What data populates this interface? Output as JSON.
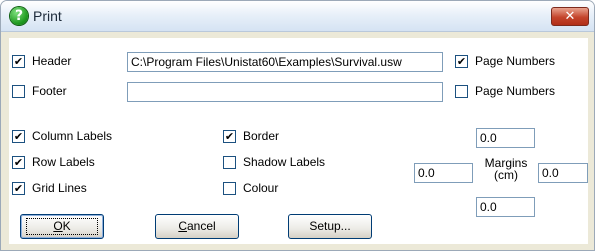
{
  "window": {
    "title": "Print",
    "close_glyph": "✕",
    "help_glyph": "?",
    "help_icon_color": "#2fa02f",
    "close_color": "#c74a31"
  },
  "header": {
    "label": "Header",
    "checked": true,
    "value": "C:\\Program Files\\Unistat60\\Examples\\Survival.usw"
  },
  "header_page_numbers": {
    "label": "Page Numbers",
    "checked": true
  },
  "footer": {
    "label": "Footer",
    "checked": false,
    "value": ""
  },
  "footer_page_numbers": {
    "label": "Page Numbers",
    "checked": false
  },
  "options_left": [
    {
      "label": "Column Labels",
      "checked": true
    },
    {
      "label": "Row Labels",
      "checked": true
    },
    {
      "label": "Grid Lines",
      "checked": true
    }
  ],
  "options_mid": [
    {
      "label": "Border",
      "checked": true
    },
    {
      "label": "Shadow Labels",
      "checked": false
    },
    {
      "label": "Colour",
      "checked": false
    }
  ],
  "margins": {
    "label_line1": "Margins",
    "label_line2": "(cm)",
    "top": "0.0",
    "left": "0.0",
    "right": "0.0",
    "bottom": "0.0"
  },
  "buttons": {
    "ok_mnemonic": "O",
    "ok_rest": "K",
    "cancel_mnemonic": "C",
    "cancel_rest": "ancel",
    "setup": "Setup..."
  },
  "check_glyph": "✔"
}
